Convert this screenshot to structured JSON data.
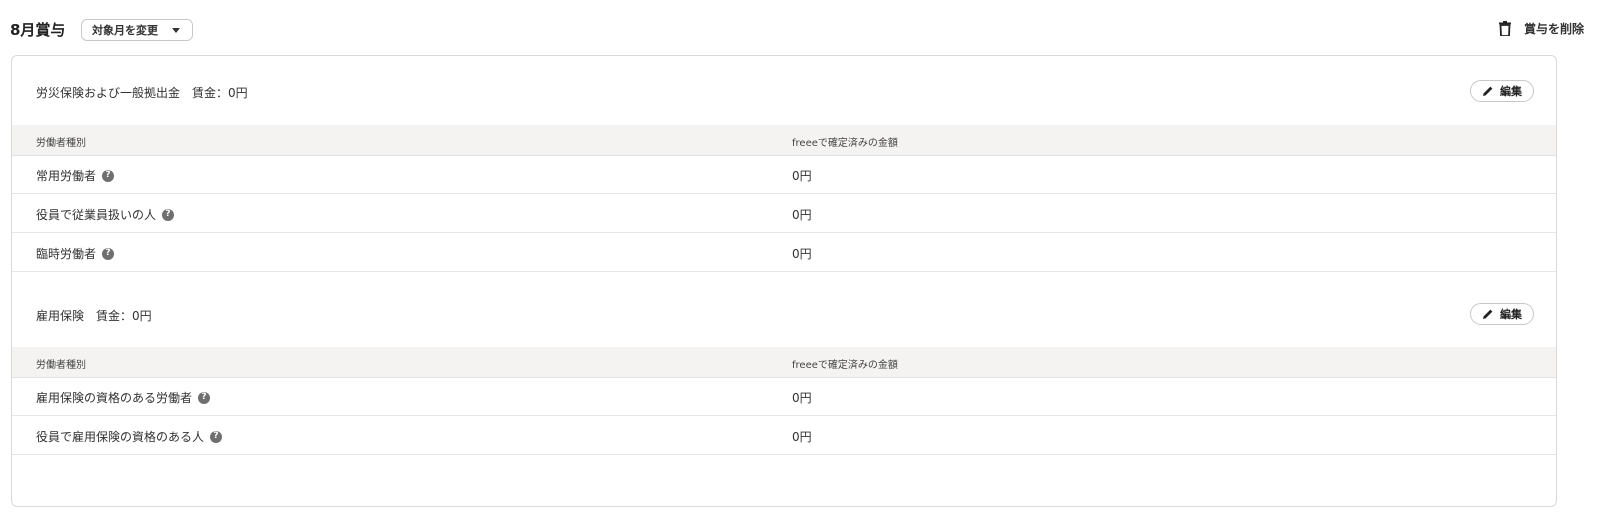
{
  "header": {
    "title": "8月賞与",
    "month_button": "対象月を変更",
    "delete_button": "賞与を削除"
  },
  "sections": [
    {
      "title": "労災保険および一般拠出金　賃金：0円",
      "edit_label": "編集",
      "col1": "労働者種別",
      "col2": "freeeで確定済みの金額",
      "rows": [
        {
          "label": "常用労働者",
          "value": "0円"
        },
        {
          "label": "役員で従業員扱いの人",
          "value": "0円"
        },
        {
          "label": "臨時労働者",
          "value": "0円"
        }
      ]
    },
    {
      "title": "雇用保険　賃金：0円",
      "edit_label": "編集",
      "col1": "労働者種別",
      "col2": "freeeで確定済みの金額",
      "rows": [
        {
          "label": "雇用保険の資格のある労働者",
          "value": "0円"
        },
        {
          "label": "役員で雇用保険の資格のある人",
          "value": "0円"
        }
      ]
    }
  ],
  "icons": {
    "help": "?",
    "help_color": "#6f6f6f"
  }
}
